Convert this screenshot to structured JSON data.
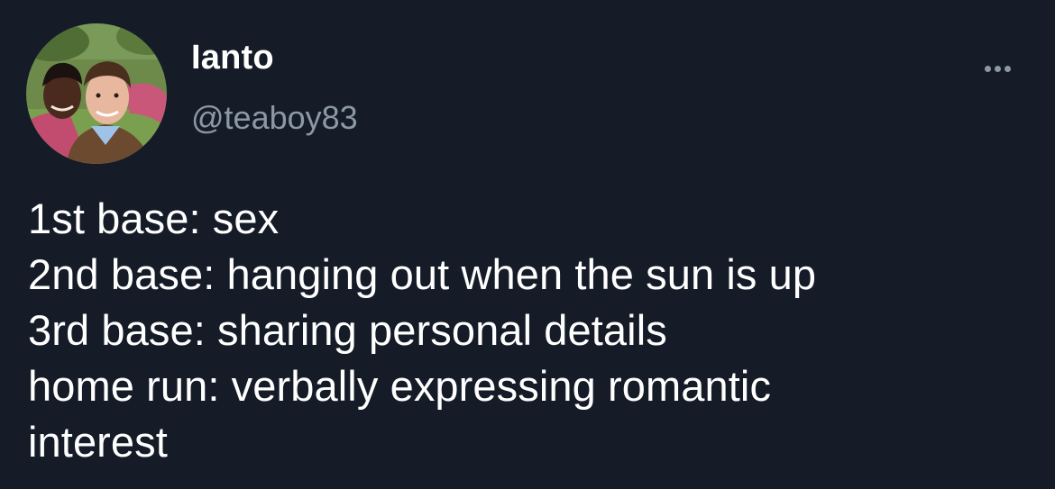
{
  "tweet": {
    "display_name": "Ianto",
    "handle": "@teaboy83",
    "more_icon": "more-horizontal-icon",
    "avatar_icon": "profile-photo",
    "lines": [
      "1st base: sex",
      "2nd base: hanging out when the sun is up",
      "3rd base: sharing personal details",
      "home run: verbally expressing romantic",
      "interest"
    ]
  },
  "colors": {
    "background": "#151c27",
    "text": "#ffffff",
    "secondary_text": "#8b98a5"
  }
}
